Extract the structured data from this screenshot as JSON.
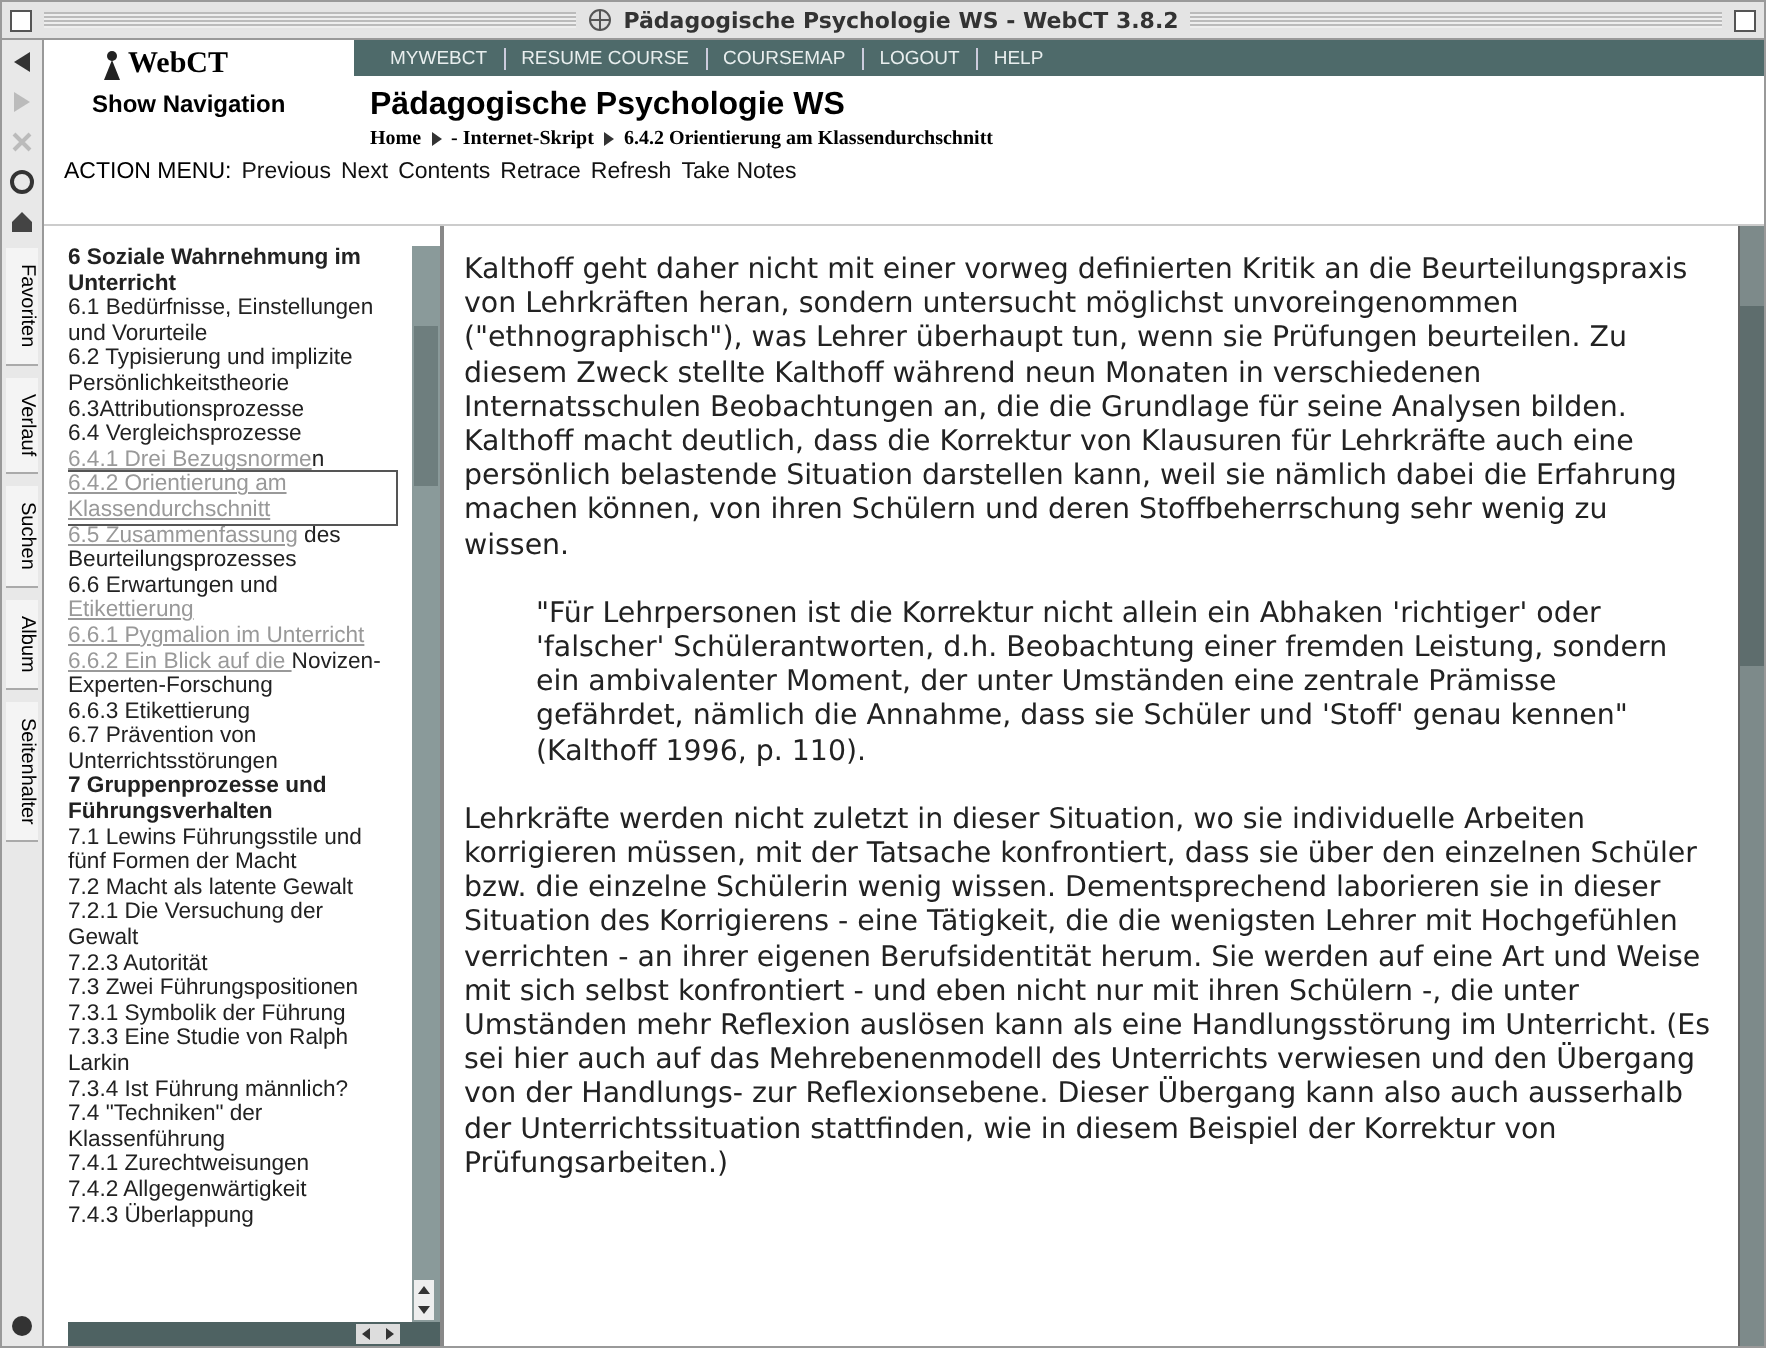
{
  "window": {
    "title": "Pädagogische Psychologie WS - WebCT 3.8.2"
  },
  "browser_sidebar": {
    "tabs": [
      {
        "label": "Favoriten"
      },
      {
        "label": "Verlauf"
      },
      {
        "label": "Suchen"
      },
      {
        "label": "Album"
      },
      {
        "label": "Seitenhalter"
      }
    ]
  },
  "header": {
    "logo": "WebCT",
    "show_navigation": "Show Navigation",
    "nav": [
      "MYWEBCT",
      "RESUME COURSE",
      "COURSEMAP",
      "LOGOUT",
      "HELP"
    ],
    "course_title": "Pädagogische Psychologie WS",
    "breadcrumb": [
      "Home",
      "- Internet-Skript",
      "6.4.2 Orientierung am Klassendurchschnitt"
    ]
  },
  "action_menu": {
    "label": "ACTION MENU:",
    "items": [
      "Previous",
      "Next",
      "Contents",
      "Retrace",
      "Refresh",
      "Take Notes"
    ]
  },
  "toc": [
    {
      "kind": "heading",
      "selected": false,
      "segments": [
        {
          "text": "6 Soziale Wahrnehmung im Unterricht",
          "muted": false
        }
      ]
    },
    {
      "kind": "entry",
      "selected": false,
      "segments": [
        {
          "text": "6.1 Bedürfnisse, Einstellungen und Vorurteile",
          "muted": false
        }
      ]
    },
    {
      "kind": "entry",
      "selected": false,
      "segments": [
        {
          "text": "6.2 Typisierung und implizite Persönlichkeitstheorie",
          "muted": false
        }
      ]
    },
    {
      "kind": "entry",
      "selected": false,
      "segments": [
        {
          "text": "6.3Attributionsprozesse",
          "muted": false
        }
      ]
    },
    {
      "kind": "entry",
      "selected": false,
      "segments": [
        {
          "text": "6.4 Vergleichsprozesse",
          "muted": false
        }
      ]
    },
    {
      "kind": "entry",
      "selected": false,
      "segments": [
        {
          "text": "6.4.1 Drei Bezugsnorme",
          "muted": true
        },
        {
          "text": "n",
          "muted": false
        }
      ]
    },
    {
      "kind": "entry",
      "selected": true,
      "segments": [
        {
          "text": "6.4.2 Orientierung am Klassendurchschnitt",
          "muted": true
        }
      ]
    },
    {
      "kind": "entry",
      "selected": false,
      "segments": [
        {
          "text": "6.5 Zusammenfassung",
          "muted": true
        },
        {
          "text": " des Beurteilungsprozesses",
          "muted": false
        }
      ]
    },
    {
      "kind": "entry",
      "selected": false,
      "segments": [
        {
          "text": "6.6 Erwartungen und ",
          "muted": false
        },
        {
          "text": "Etikettierung",
          "muted": true
        }
      ]
    },
    {
      "kind": "entry",
      "selected": false,
      "segments": [
        {
          "text": "6.6.1 Pygmalion im Unterricht",
          "muted": true
        }
      ]
    },
    {
      "kind": "entry",
      "selected": false,
      "segments": [
        {
          "text": "6.6.2 Ein Blick auf die ",
          "muted": true
        },
        {
          "text": "Novizen-Experten-Forschung",
          "muted": false
        }
      ]
    },
    {
      "kind": "entry",
      "selected": false,
      "segments": [
        {
          "text": "6.6.3 Etikettierung",
          "muted": false
        }
      ]
    },
    {
      "kind": "entry",
      "selected": false,
      "segments": [
        {
          "text": "6.7 Prävention von Unterrichtsstörungen",
          "muted": false
        }
      ]
    },
    {
      "kind": "heading",
      "selected": false,
      "segments": [
        {
          "text": "7 Gruppenprozesse und Führungsverhalten",
          "muted": false
        }
      ]
    },
    {
      "kind": "entry",
      "selected": false,
      "segments": [
        {
          "text": "7.1 Lewins Führungsstile und fünf Formen der Macht",
          "muted": false
        }
      ]
    },
    {
      "kind": "entry",
      "selected": false,
      "segments": [
        {
          "text": "7.2 Macht als latente Gewalt",
          "muted": false
        }
      ]
    },
    {
      "kind": "entry",
      "selected": false,
      "segments": [
        {
          "text": "7.2.1 Die Versuchung der Gewalt",
          "muted": false
        }
      ]
    },
    {
      "kind": "entry",
      "selected": false,
      "segments": [
        {
          "text": "7.2.3 Autorität",
          "muted": false
        }
      ]
    },
    {
      "kind": "entry",
      "selected": false,
      "segments": [
        {
          "text": "7.3 Zwei Führungspositionen",
          "muted": false
        }
      ]
    },
    {
      "kind": "entry",
      "selected": false,
      "segments": [
        {
          "text": "7.3.1 Symbolik der Führung",
          "muted": false
        }
      ]
    },
    {
      "kind": "entry",
      "selected": false,
      "segments": [
        {
          "text": "7.3.3 Eine Studie von Ralph Larkin",
          "muted": false
        }
      ]
    },
    {
      "kind": "entry",
      "selected": false,
      "segments": [
        {
          "text": "7.3.4 Ist Führung männlich?",
          "muted": false
        }
      ]
    },
    {
      "kind": "entry",
      "selected": false,
      "segments": [
        {
          "text": "7.4 \"Techniken\" der Klassenführung",
          "muted": false
        }
      ]
    },
    {
      "kind": "entry",
      "selected": false,
      "segments": [
        {
          "text": "7.4.1 Zurechtweisungen",
          "muted": false
        }
      ]
    },
    {
      "kind": "entry",
      "selected": false,
      "segments": [
        {
          "text": "7.4.2 Allgegenwärtigkeit",
          "muted": false
        }
      ]
    },
    {
      "kind": "entry",
      "selected": false,
      "segments": [
        {
          "text": "7.4.3 Überlappung",
          "muted": false
        }
      ]
    }
  ],
  "content": [
    {
      "kind": "paragraph",
      "text": "Kalthoff geht daher nicht mit einer vorweg definierten Kritik an die Beurteilungspraxis von Lehrkräften heran, sondern untersucht möglichst unvoreingenommen (\"ethnographisch\"), was Lehrer überhaupt tun, wenn sie Prüfungen beurteilen. Zu diesem Zweck stellte Kalthoff während neun Monaten in verschiedenen Internatsschulen Beobachtungen an, die die Grundlage für seine Analysen bilden. Kalthoff macht deutlich, dass die Korrektur von Klausuren für Lehrkräfte auch eine persönlich belastende Situation darstellen kann, weil sie nämlich dabei die Erfahrung machen können, von ihren Schülern und deren Stoffbeherrschung sehr wenig zu wissen."
    },
    {
      "kind": "quote",
      "text": "\"Für Lehrpersonen ist die Korrektur nicht allein ein Abhaken 'richtiger' oder 'falscher' Schülerantworten, d.h. Beobachtung einer fremden Leistung, sondern ein ambivalenter Moment, der unter Umständen eine zentrale Prämisse gefährdet, nämlich die Annahme, dass sie Schüler und 'Stoff' genau kennen\" (Kalthoff 1996, p. 110)."
    },
    {
      "kind": "paragraph",
      "text": "Lehrkräfte werden nicht zuletzt in dieser Situation, wo sie individuelle Arbeiten korrigieren müssen, mit der Tatsache konfrontiert, dass sie über den einzelnen Schüler bzw. die einzelne Schülerin wenig wissen. Dementsprechend laborieren sie in dieser Situation des Korrigierens - eine Tätigkeit, die die wenigsten Lehrer mit Hochgefühlen verrichten - an ihrer eigenen Berufsidentität herum. Sie werden auf eine Art und Weise mit sich selbst konfrontiert - und eben nicht nur mit ihren Schülern -, die unter Umständen mehr Reflexion auslösen kann als eine Handlungsstörung im Unterricht. (Es sei hier auch auf das Mehrebenenmodell des Unterrichts verwiesen und den Übergang von der Handlungs- zur Reflexionsebene. Dieser Übergang kann also auch ausserhalb der Unterrichtssituation stattfinden, wie in diesem Beispiel der Korrektur von Prüfungsarbeiten.)"
    }
  ]
}
